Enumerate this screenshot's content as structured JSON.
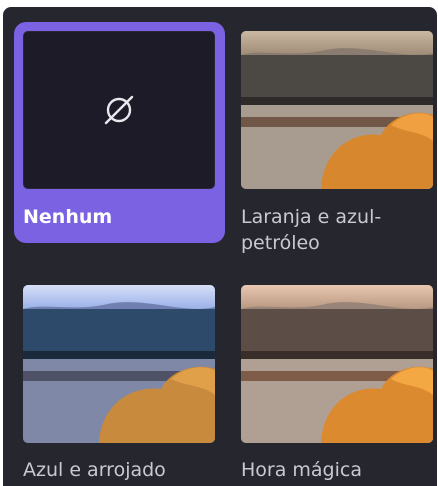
{
  "filters": [
    {
      "label": "Nenhum",
      "selected": true,
      "icon": "no-filter-icon"
    },
    {
      "label": "Laranja e azul-\npetróleo",
      "selected": false,
      "tint": "#e07a3a"
    },
    {
      "label": "Azul e arrojado",
      "selected": false,
      "tint": "#4a6fd8"
    },
    {
      "label": "Hora mágica",
      "selected": false,
      "tint": "#d88040"
    }
  ],
  "colors": {
    "panel_bg": "#26262f",
    "selected_bg": "#7a62e2",
    "label_text": "#c9c9cf"
  }
}
